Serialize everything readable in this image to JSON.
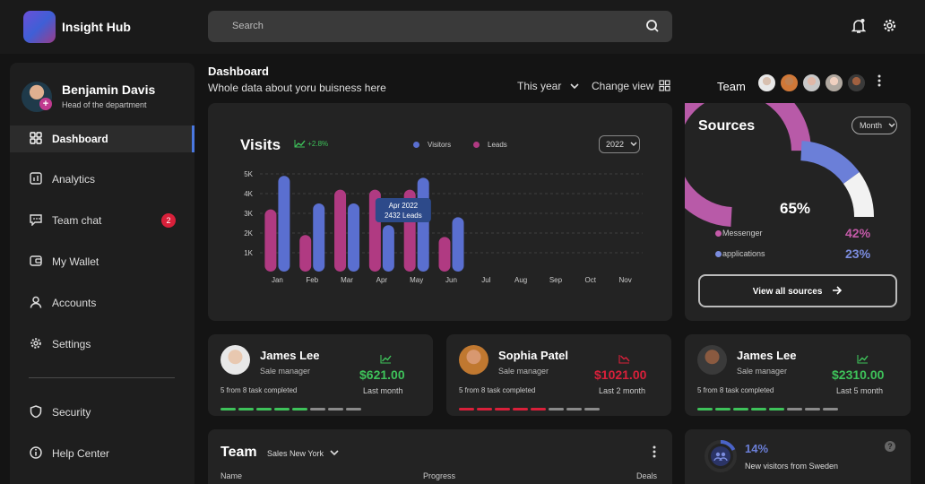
{
  "app": {
    "title": "Insight Hub"
  },
  "search": {
    "placeholder": "Search"
  },
  "user": {
    "name": "Benjamin Davis",
    "role": "Head of the department",
    "badge": "+"
  },
  "sidebar": {
    "items": [
      {
        "label": "Dashboard",
        "icon": "dashboard-grid-icon",
        "active": true
      },
      {
        "label": "Analytics",
        "icon": "analytics-icon"
      },
      {
        "label": "Team chat",
        "icon": "chat-icon",
        "badge": "2"
      },
      {
        "label": "My Wallet",
        "icon": "wallet-icon"
      },
      {
        "label": "Accounts",
        "icon": "user-icon"
      },
      {
        "label": "Settings",
        "icon": "gear-icon"
      },
      {
        "label": "Security",
        "icon": "shield-icon"
      },
      {
        "label": "Help Center",
        "icon": "info-icon"
      }
    ]
  },
  "header": {
    "title": "Dashboard",
    "subtitle": "Whole data about yoru buisness here",
    "period": "This year",
    "change_view": "Change view",
    "team_label": "Team"
  },
  "visits": {
    "title": "Visits",
    "trend": "+2.8%",
    "year": "2022"
  },
  "chart_data": {
    "type": "bar",
    "title": "Visits",
    "categories": [
      "Jan",
      "Feb",
      "Mar",
      "Apr",
      "May",
      "Jun",
      "Jul",
      "Aug",
      "Sep",
      "Oct",
      "Nov"
    ],
    "y_ticks": [
      "1K",
      "2K",
      "3K",
      "4K",
      "5K"
    ],
    "ylim": [
      0.5,
      5
    ],
    "series": [
      {
        "name": "Leads",
        "color": "#b03a82",
        "values": [
          3.2,
          1.9,
          4.2,
          4.2,
          4.2,
          1.8,
          null,
          null,
          null,
          null,
          null
        ]
      },
      {
        "name": "Visitors",
        "color": "#5a6fd0",
        "values": [
          4.9,
          3.5,
          3.5,
          2.4,
          4.8,
          2.8,
          null,
          null,
          null,
          null,
          null
        ]
      }
    ],
    "tooltip": {
      "label": "Apr 2022",
      "value": "2432 Leads"
    },
    "grid": true,
    "legend": "top"
  },
  "sources": {
    "title": "Sources",
    "period": "Month",
    "center": "65%",
    "gauge": {
      "messenger": 0.42,
      "applications": 0.23,
      "arc_color_1": "#b85aa8",
      "arc_color_2": "#6b7fd8"
    },
    "items": [
      {
        "label": "Messenger",
        "value": "42%",
        "color": "#c45aa8"
      },
      {
        "label": "applications",
        "value": "23%",
        "color": "#7b8cde"
      }
    ],
    "cta": "View all sources"
  },
  "people": [
    {
      "name": "James Lee",
      "role": "Sale manager",
      "amount": "$621.00",
      "period": "Last month",
      "tasks": "5 from 8 task completed",
      "color": "#3ec25a",
      "done": 5,
      "total": 8
    },
    {
      "name": "Sophia Patel",
      "role": "Sale manager",
      "amount": "$1021.00",
      "period": "Last 2 month",
      "tasks": "5 from 8 task completed",
      "color": "#d8203a",
      "done": 5,
      "total": 8
    },
    {
      "name": "James Lee",
      "role": "Sale manager",
      "amount": "$2310.00",
      "period": "Last 5 month",
      "tasks": "5 from 8 task completed",
      "color": "#3ec25a",
      "done": 5,
      "total": 8
    }
  ],
  "team_table": {
    "title": "Team",
    "filter": "Sales New York",
    "columns": [
      "Name",
      "Progress",
      "Deals"
    ]
  },
  "visitors": {
    "pct": "14%",
    "text": "New visitors from Sweden",
    "help": "?"
  }
}
